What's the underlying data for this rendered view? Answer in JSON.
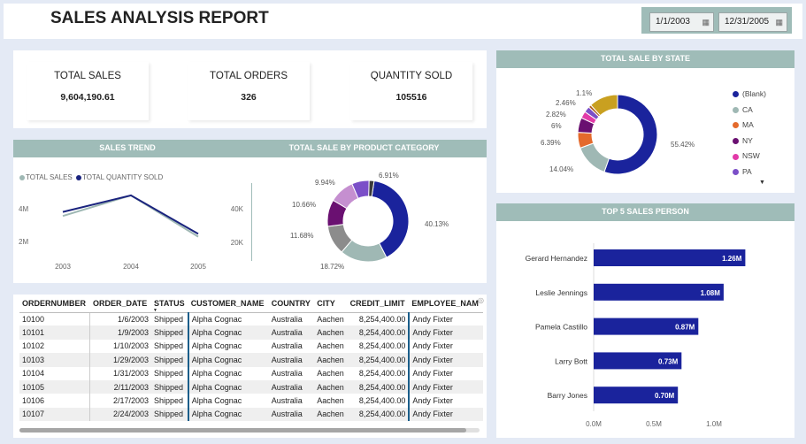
{
  "header": {
    "title": "SALES ANALYSIS REPORT",
    "date_from": "1/1/2003",
    "date_to": "12/31/2005"
  },
  "kpis": [
    {
      "label": "TOTAL SALES",
      "value": "9,604,190.61"
    },
    {
      "label": "TOTAL ORDERS",
      "value": "326"
    },
    {
      "label": "QUANTITY SOLD",
      "value": "105516"
    }
  ],
  "sales_trend": {
    "title": "SALES TREND",
    "legend": [
      "TOTAL SALES",
      "TOTAL QUANTITY SOLD"
    ],
    "left_ticks": [
      "4M",
      "2M"
    ],
    "right_ticks": [
      "40K",
      "20K"
    ],
    "x_ticks": [
      "2003",
      "2004",
      "2005"
    ],
    "colors": {
      "sales": "#9fb8b4",
      "quantity": "#1a237e"
    }
  },
  "product_category": {
    "title": "TOTAL SALE BY PRODUCT CATEGORY",
    "labels": [
      "40.13%",
      "18.72%",
      "11.68%",
      "10.66%",
      "9.94%",
      "6.91%"
    ]
  },
  "state": {
    "title": "TOTAL SALE BY STATE",
    "labels": [
      "55.42%",
      "14.04%",
      "6.39%",
      "6%",
      "2.82%",
      "2.46%",
      "1.1%"
    ],
    "legend": [
      {
        "name": "(Blank)",
        "color": "#1a239c"
      },
      {
        "name": "CA",
        "color": "#9fb8b4"
      },
      {
        "name": "MA",
        "color": "#e46a2c"
      },
      {
        "name": "NY",
        "color": "#6a1071"
      },
      {
        "name": "NSW",
        "color": "#e23aa8"
      },
      {
        "name": "PA",
        "color": "#7b4fc8"
      }
    ]
  },
  "top_sales": {
    "title": "TOP 5 SALES PERSON",
    "x_ticks": [
      "0.0M",
      "0.5M",
      "1.0M"
    ]
  },
  "table": {
    "columns": [
      "ORDERNUMBER",
      "ORDER_DATE",
      "STATUS",
      "CUSTOMER_NAME",
      "COUNTRY",
      "CITY",
      "CREDIT_LIMIT",
      "EMPLOYEE_NAM"
    ],
    "rows": [
      [
        "10100",
        "1/6/2003",
        "Shipped",
        "Alpha Cognac",
        "Australia",
        "Aachen",
        "8,254,400.00",
        "Andy Fixter"
      ],
      [
        "10101",
        "1/9/2003",
        "Shipped",
        "Alpha Cognac",
        "Australia",
        "Aachen",
        "8,254,400.00",
        "Andy Fixter"
      ],
      [
        "10102",
        "1/10/2003",
        "Shipped",
        "Alpha Cognac",
        "Australia",
        "Aachen",
        "8,254,400.00",
        "Andy Fixter"
      ],
      [
        "10103",
        "1/29/2003",
        "Shipped",
        "Alpha Cognac",
        "Australia",
        "Aachen",
        "8,254,400.00",
        "Andy Fixter"
      ],
      [
        "10104",
        "1/31/2003",
        "Shipped",
        "Alpha Cognac",
        "Australia",
        "Aachen",
        "8,254,400.00",
        "Andy Fixter"
      ],
      [
        "10105",
        "2/11/2003",
        "Shipped",
        "Alpha Cognac",
        "Australia",
        "Aachen",
        "8,254,400.00",
        "Andy Fixter"
      ],
      [
        "10106",
        "2/17/2003",
        "Shipped",
        "Alpha Cognac",
        "Australia",
        "Aachen",
        "8,254,400.00",
        "Andy Fixter"
      ],
      [
        "10107",
        "2/24/2003",
        "Shipped",
        "Alpha Cognac",
        "Australia",
        "Aachen",
        "8,254,400.00",
        "Andy Fixter"
      ]
    ]
  },
  "chart_data": [
    {
      "type": "line",
      "title": "SALES TREND",
      "x": [
        "2003",
        "2004",
        "2005"
      ],
      "series": [
        {
          "name": "TOTAL SALES",
          "axis": "left",
          "values": [
            3300000,
            4800000,
            1800000
          ]
        },
        {
          "name": "TOTAL QUANTITY SOLD",
          "axis": "right",
          "values": [
            36000,
            48000,
            20000
          ]
        }
      ],
      "ylim_left": [
        1000000,
        5500000
      ],
      "ylim_right": [
        10000,
        55000
      ]
    },
    {
      "type": "pie",
      "title": "TOTAL SALE BY PRODUCT CATEGORY",
      "slices": [
        {
          "value": 40.13,
          "color": "#1a239c"
        },
        {
          "value": 18.72,
          "color": "#9fb8b4"
        },
        {
          "value": 11.68,
          "color": "#8c8c8c"
        },
        {
          "value": 10.66,
          "color": "#6a1071"
        },
        {
          "value": 9.94,
          "color": "#c58fd0"
        },
        {
          "value": 6.91,
          "color": "#7b4fc8"
        },
        {
          "value": 1.96,
          "color": "#3a3a3a"
        }
      ]
    },
    {
      "type": "pie",
      "title": "TOTAL SALE BY STATE",
      "slices": [
        {
          "name": "(Blank)",
          "value": 55.42,
          "color": "#1a239c"
        },
        {
          "name": "CA",
          "value": 14.04,
          "color": "#9fb8b4"
        },
        {
          "name": "MA",
          "value": 6.39,
          "color": "#e46a2c"
        },
        {
          "name": "NY",
          "value": 6.0,
          "color": "#6a1071"
        },
        {
          "name": "NSW",
          "value": 2.82,
          "color": "#e23aa8"
        },
        {
          "name": "PA",
          "value": 2.46,
          "color": "#7b4fc8"
        },
        {
          "value": 1.1,
          "color": "#b06020"
        },
        {
          "value": 11.77,
          "color": "#c9a020"
        }
      ]
    },
    {
      "type": "bar",
      "title": "TOP 5 SALES PERSON",
      "orientation": "horizontal",
      "categories": [
        "Gerard Hernandez",
        "Leslie Jennings",
        "Pamela Castillo",
        "Larry Bott",
        "Barry Jones"
      ],
      "values": [
        1.26,
        1.08,
        0.87,
        0.73,
        0.7
      ],
      "labels": [
        "1.26M",
        "1.08M",
        "0.87M",
        "0.73M",
        "0.70M"
      ],
      "xlim": [
        0,
        1.4
      ],
      "color": "#1a239c"
    }
  ]
}
